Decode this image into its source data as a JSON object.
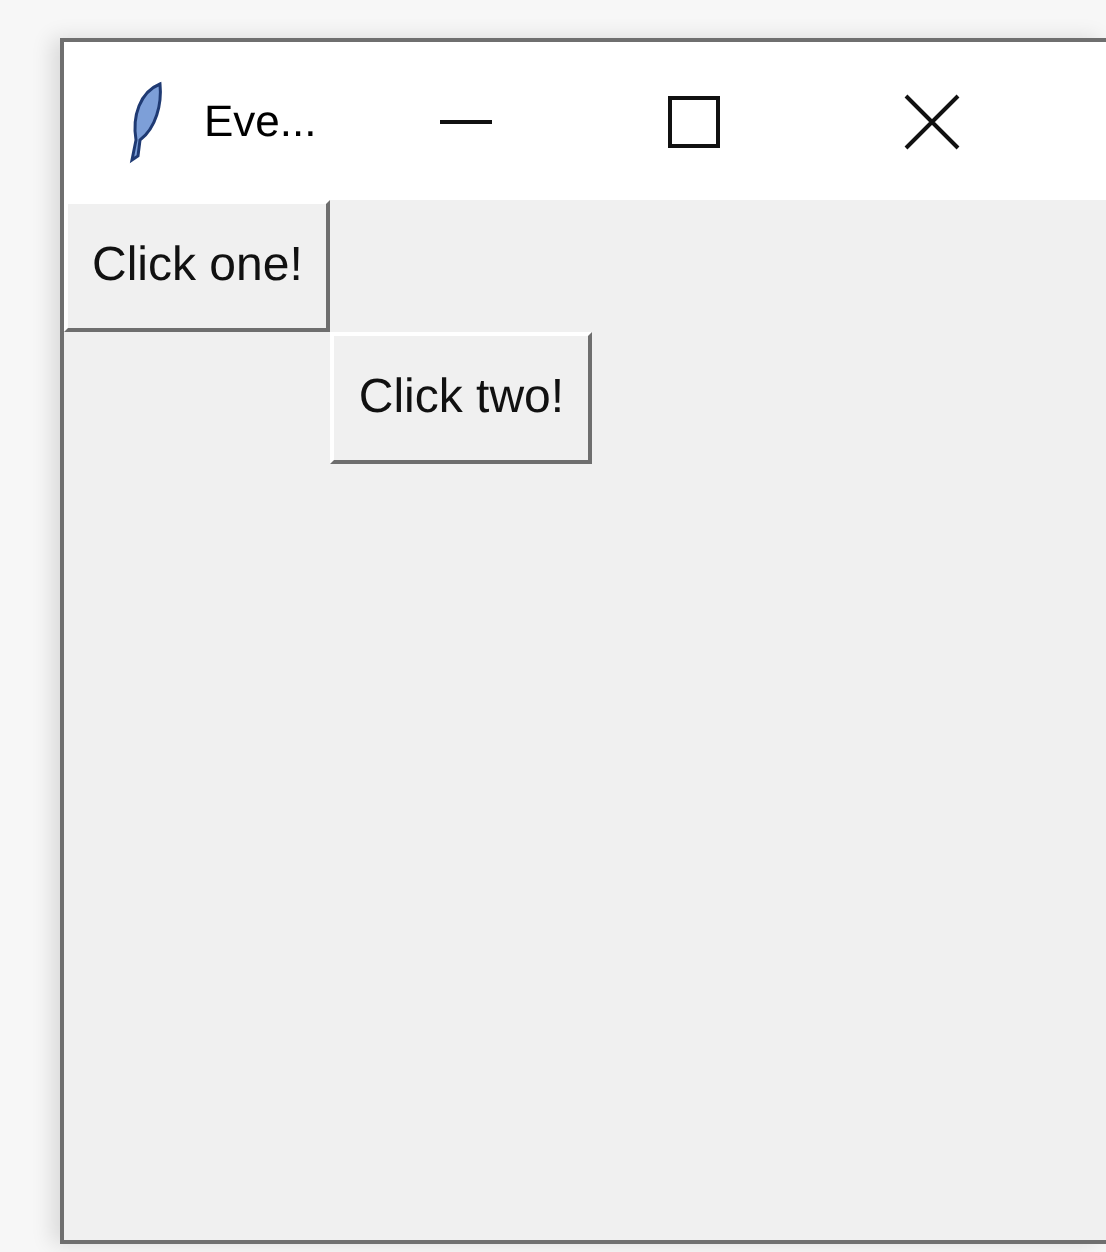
{
  "window": {
    "title": "Eve..."
  },
  "buttons": [
    {
      "label": "Click one!"
    },
    {
      "label": "Click two!"
    }
  ]
}
